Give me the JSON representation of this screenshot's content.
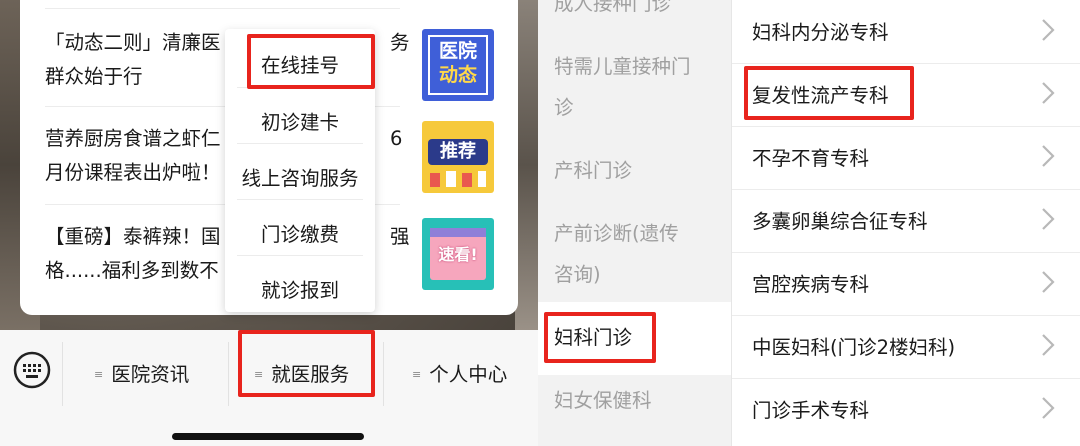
{
  "left": {
    "news": [
      {
        "line1": "「动态二则」清廉医",
        "line2": "群众始于行",
        "tail1": "务"
      },
      {
        "line1": "营养厨房食谱之虾仁",
        "line2": "月份课程表出炉啦！",
        "tail1": "6"
      },
      {
        "line1": "【重磅】泰裤辣！国",
        "line2": "格......福利多到数不",
        "tail1": "强"
      }
    ],
    "thumbs": [
      {
        "text1": "医院",
        "text2": "动态",
        "color": "#3f5fd8"
      },
      {
        "text1": "推荐",
        "text2": "",
        "color": "#f6c93b"
      },
      {
        "text1": "速看!",
        "text2": "",
        "color": "#27c0b7"
      }
    ],
    "menu": [
      "在线挂号",
      "初诊建卡",
      "线上咨询服务",
      "门诊缴费",
      "就诊报到"
    ],
    "tabs": [
      "医院资讯",
      "就医服务",
      "个人中心"
    ],
    "highlight_color": "#e8241d"
  },
  "middle": {
    "items": [
      "成人接种门诊",
      "特需儿童接种门",
      "诊",
      "产科门诊",
      "产前诊断(遗传",
      "咨询)",
      "妇科门诊",
      "妇女保健科"
    ]
  },
  "right": {
    "rows": [
      "妇科内分泌专科",
      "复发性流产专科",
      "不孕不育专科",
      "多囊卵巢综合征专科",
      "宫腔疾病专科",
      "中医妇科(门诊2楼妇科)",
      "门诊手术专科"
    ]
  }
}
